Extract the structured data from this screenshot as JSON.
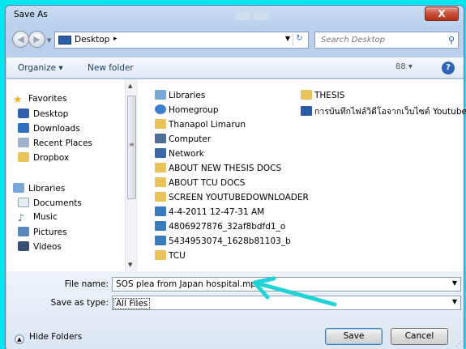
{
  "window": {
    "title": "Save As",
    "close_label": "X"
  },
  "address": {
    "location": "Desktop",
    "separator": "▸",
    "search_placeholder": "Search Desktop"
  },
  "toolbar": {
    "organize": "Organize ▾",
    "new_folder": "New folder",
    "views": "88 ▾",
    "help": "?"
  },
  "nav": {
    "favorites": "Favorites",
    "items": [
      "Desktop",
      "Downloads",
      "Recent Places",
      "Dropbox"
    ],
    "libraries": "Libraries",
    "library_items": [
      "Documents",
      "Music",
      "Pictures",
      "Videos"
    ]
  },
  "files": {
    "col1": [
      "Libraries",
      "Homegroup",
      "Thanapol Limarun",
      "Computer",
      "Network",
      "ABOUT NEW THESIS DOCS",
      "ABOUT TCU DOCS",
      "SCREEN YOUTUBEDOWNLOADER",
      "4-4-2011 12-47-31 AM",
      "4806927876_32af8bdfd1_o",
      "5434953074_1628b81103_b",
      "TCU"
    ],
    "col2": [
      "THESIS",
      "การบันทึกไฟล์วิดีโอจากเว็บไซต์ Youtube"
    ]
  },
  "form": {
    "file_name_label": "File name:",
    "file_name_value": "SOS plea from Japan hospital.mp4",
    "save_type_label": "Save as type:",
    "save_type_value": "All Files"
  },
  "buttons": {
    "hide_folders": "Hide Folders",
    "save": "Save",
    "cancel": "Cancel"
  },
  "colors": {
    "frame": "#00e5ee",
    "annotation_arrow": "#22d3d6",
    "folder": "#e8c25a"
  }
}
